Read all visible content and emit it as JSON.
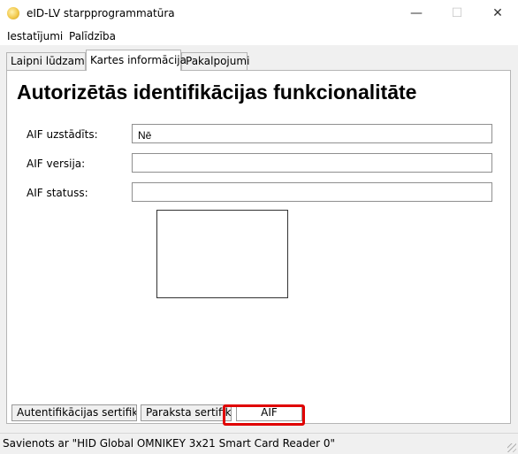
{
  "window": {
    "title": "eID-LV starpprogrammatūra",
    "minimize_glyph": "—",
    "maximize_glyph": "☐",
    "close_glyph": "✕",
    "app_icon": "sun-logo-icon"
  },
  "menu": {
    "settings": "Iestatījumi",
    "help": "Palīdzība"
  },
  "tabs": {
    "welcome": "Laipni lūdzam!",
    "card_info": "Kartes informācija",
    "services": "Pakalpojumi",
    "active": "card_info"
  },
  "main": {
    "heading": "Autorizētās identifikācijas funkcionalitāte",
    "fields": {
      "aif_installed": {
        "label": "AIF uzstādīts:",
        "value": "Nē"
      },
      "aif_version": {
        "label": "AIF versija:",
        "value": ""
      },
      "aif_status": {
        "label": "AIF statuss:",
        "value": ""
      }
    }
  },
  "subtabs": {
    "auth_cert": "Autentifikācijas sertifikāts",
    "sign_cert": "Paraksta sertifikāts",
    "aif": "AIF",
    "active": "aif",
    "highlight_color": "#e00000"
  },
  "status": {
    "text": "Savienots ar \"HID Global OMNIKEY 3x21 Smart Card Reader 0\""
  }
}
